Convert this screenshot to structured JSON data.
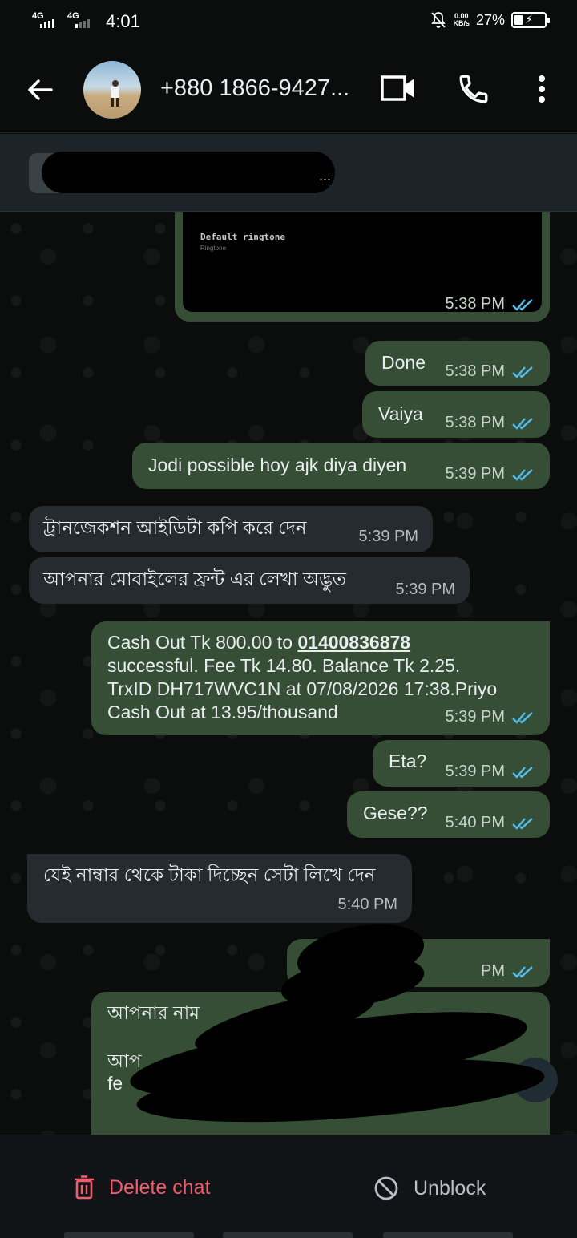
{
  "status_bar": {
    "network1": "4G",
    "network2": "4G",
    "time": "4:01",
    "data_rate_value": "0.00",
    "data_rate_unit": "KB/s",
    "battery": "27%",
    "battery_level": 0.27
  },
  "header": {
    "contact_name": "+880 1866-9427..."
  },
  "pinned": {
    "suffix": "..."
  },
  "messages": [
    {
      "type": "out-media",
      "caption": "Default ringtone",
      "subcaption": "Ringtone",
      "time": "5:38 PM"
    },
    {
      "type": "out",
      "text": "Done",
      "time": "5:38 PM"
    },
    {
      "type": "out",
      "text": "Vaiya",
      "time": "5:38 PM"
    },
    {
      "type": "out",
      "text": "Jodi possible hoy ajk diya diyen",
      "time": "5:39 PM"
    },
    {
      "type": "in",
      "text": "ট্রানজেকশন আইডিটা কপি করে দেন",
      "time": "5:39 PM"
    },
    {
      "type": "in",
      "text": "আপনার মোবাইলের ফ্রন্ট এর লেখা অদ্ভুত",
      "time": "5:39 PM"
    },
    {
      "type": "out",
      "lines": [
        "Cash Out Tk 800.00 to ",
        "01400836878",
        "successful. Fee Tk 14.80. Balance Tk 2.25.",
        "TrxID DH717WVC1N at 07/08/2026 17:38.Priyo",
        "Cash Out at 13.95/thousand"
      ],
      "time": "5:39 PM"
    },
    {
      "type": "out",
      "text": "Eta?",
      "time": "5:39 PM"
    },
    {
      "type": "out",
      "text": "Gese??",
      "time": "5:40 PM"
    },
    {
      "type": "in",
      "text": "যেই নাম্বার থেকে টাকা দিচ্ছেন সেটা লিখে দেন",
      "time": "5:40 PM"
    },
    {
      "type": "out-redacted",
      "time": "PM"
    },
    {
      "type": "out-partial",
      "line1": "আপনার নাম",
      "line2": "আপ",
      "line3": "fe"
    }
  ],
  "bottom": {
    "delete_label": "Delete chat",
    "unblock_label": "Unblock"
  },
  "colors": {
    "outgoing_bubble": "#354e35",
    "incoming_bubble": "#262b2f",
    "read_ticks": "#53bdeb",
    "delete_red": "#f15c6d"
  }
}
